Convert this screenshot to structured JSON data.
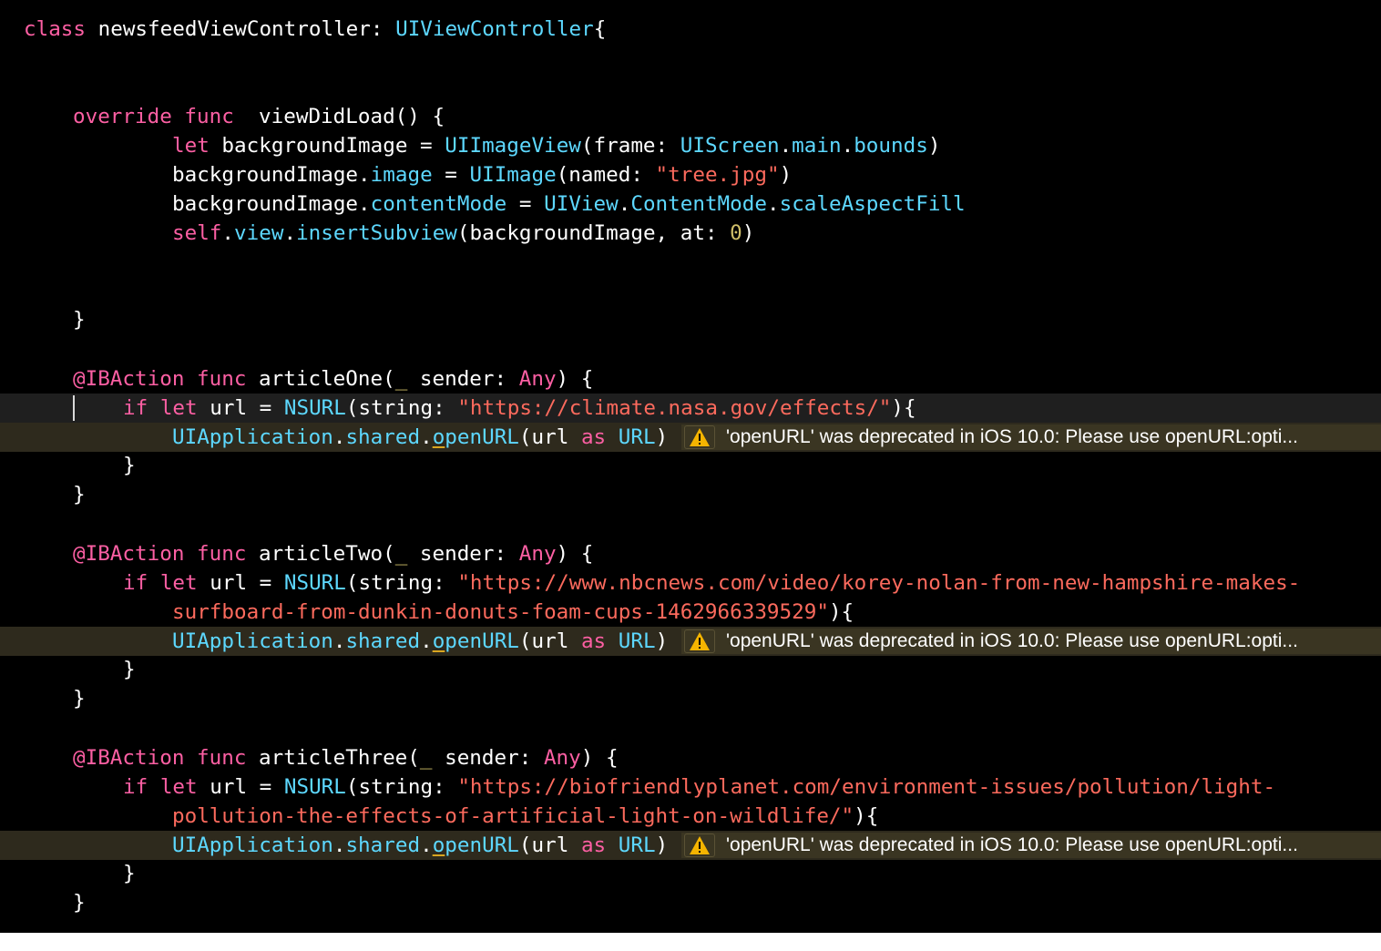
{
  "editor": {
    "class_decl": {
      "kw": "class",
      "name": " newsfeedViewController: ",
      "parent": "UIViewController",
      "brace": "{"
    },
    "view_did_load": {
      "sig": {
        "kw1": "override",
        "kw2": " func",
        "name": "  viewDidLoad() {"
      },
      "l1": {
        "kw": "let",
        "a": " backgroundImage = ",
        "t1": "UIImageView",
        "b": "(frame: ",
        "t2": "UIScreen",
        "d1": ".",
        "t3": "main",
        "d2": ".",
        "t4": "bounds",
        "c": ")"
      },
      "l2": {
        "a": "backgroundImage.",
        "t1": "image",
        "b": " = ",
        "t2": "UIImage",
        "c": "(named: ",
        "s": "\"tree.jpg\"",
        "d": ")"
      },
      "l3": {
        "a": "backgroundImage.",
        "t1": "contentMode",
        "b": " = ",
        "t2": "UIView",
        "d1": ".",
        "t3": "ContentMode",
        "d2": ".",
        "t4": "scaleAspectFill"
      },
      "l4": {
        "kw": "self",
        "d1": ".",
        "t1": "view",
        "d2": ".",
        "t2": "insertSubview",
        "a": "(backgroundImage, at: ",
        "n": "0",
        "b": ")"
      },
      "close": "}"
    },
    "actions": [
      {
        "sig": {
          "attr": "@IBAction",
          "kw": " func",
          "name": " articleOne(",
          "us": "_",
          "b": " sender: ",
          "any": "Any",
          "c": ") {"
        },
        "if": {
          "kw1": "if",
          "kw2": " let",
          "a": " url = ",
          "t": "NSURL",
          "b": "(string: ",
          "s1": "\"https://climate.nasa.gov/effects/\"",
          "s2": "",
          "c": "){"
        },
        "open": {
          "t1": "UIApplication",
          "d1": ".",
          "t2": "shared",
          "d2": ".",
          "m1": "o",
          "m2": "penURL",
          "a": "(url ",
          "kw": "as",
          "b": " ",
          "t3": "URL",
          "c": ")"
        },
        "warning": "'openURL' was deprecated in iOS 10.0: Please use openURL:opti...",
        "close_if": "}",
        "close_fn": "}"
      },
      {
        "sig": {
          "attr": "@IBAction",
          "kw": " func",
          "name": " articleTwo(",
          "us": "_",
          "b": " sender: ",
          "any": "Any",
          "c": ") {"
        },
        "if": {
          "kw1": "if",
          "kw2": " let",
          "a": " url = ",
          "t": "NSURL",
          "b": "(string: ",
          "s1": "\"https://www.nbcnews.com/video/korey-nolan-from-new-hampshire-makes-",
          "s2": "surfboard-from-dunkin-donuts-foam-cups-1462966339529\"",
          "c": "){"
        },
        "open": {
          "t1": "UIApplication",
          "d1": ".",
          "t2": "shared",
          "d2": ".",
          "m1": "o",
          "m2": "penURL",
          "a": "(url ",
          "kw": "as",
          "b": " ",
          "t3": "URL",
          "c": ")"
        },
        "warning": "'openURL' was deprecated in iOS 10.0: Please use openURL:opti...",
        "close_if": "}",
        "close_fn": "}"
      },
      {
        "sig": {
          "attr": "@IBAction",
          "kw": " func",
          "name": " articleThree(",
          "us": "_",
          "b": " sender: ",
          "any": "Any",
          "c": ") {"
        },
        "if": {
          "kw1": "if",
          "kw2": " let",
          "a": " url = ",
          "t": "NSURL",
          "b": "(string: ",
          "s1": "\"https://biofriendlyplanet.com/environment-issues/pollution/light-",
          "s2": "pollution-the-effects-of-artificial-light-on-wildlife/\"",
          "c": "){"
        },
        "open": {
          "t1": "UIApplication",
          "d1": ".",
          "t2": "shared",
          "d2": ".",
          "m1": "o",
          "m2": "penURL",
          "a": "(url ",
          "kw": "as",
          "b": " ",
          "t3": "URL",
          "c": ")"
        },
        "warning": "'openURL' was deprecated in iOS 10.0: Please use openURL:opti...",
        "close_if": "}",
        "close_fn": "}"
      }
    ],
    "colors": {
      "background": "#000000",
      "keyword": "#fc5fa3",
      "type": "#5dd8ff",
      "string": "#fc6a5d",
      "number": "#d0bf69",
      "plain": "#ffffff",
      "warning_line": "#2e2a1d",
      "warning_icon": "#f5b400"
    },
    "icons": {
      "warning": "warning-triangle-icon"
    }
  }
}
